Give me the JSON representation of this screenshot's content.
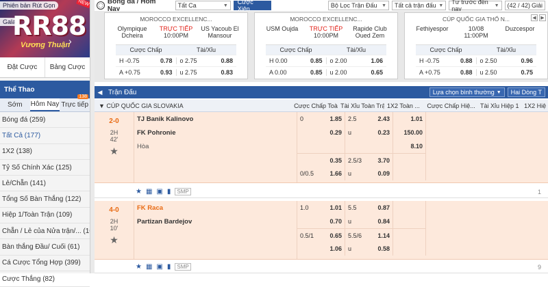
{
  "sidebar": {
    "banner": {
      "pill": "Phiên bản Rút Gọn",
      "pill2": "Gala",
      "logo": "RR88",
      "sub": "Vương Thuận",
      "new": "NEW"
    },
    "links": [
      "Đặt Cược",
      "Bảng Cược"
    ],
    "title": "Thể Thao",
    "tabs": [
      "Sớm",
      "Hôm Nay",
      "Trực tiếp"
    ],
    "live_count": "138",
    "items": [
      {
        "label": "Bóng đá (259)"
      },
      {
        "label": "Tất Cả (177)"
      },
      {
        "label": "1X2 (138)"
      },
      {
        "label": "Tỷ Số Chính Xác (125)"
      },
      {
        "label": "Lẻ/Chẵn (141)"
      },
      {
        "label": "Tổng Số Bàn Thắng (122)"
      },
      {
        "label": "Hiệp 1/Toàn Trận (109)"
      },
      {
        "label": "Chẵn / Lẻ của Nửa trận/... (101)"
      },
      {
        "label": "Bàn thắng Đầu/ Cuối (61)"
      },
      {
        "label": "Cá Cược Tổng Hợp (399)"
      },
      {
        "label": "Cược Thắng (82)"
      }
    ]
  },
  "topbar": {
    "title": "Bóng đá / Hôm Nay",
    "all": "Tất Ca",
    "parlay": "Cược Xiên",
    "filter": "Bộ Lọc Trận Đấu",
    "all_matches": "Tất cả trận đấu",
    "sort": "Tư trước đến nay",
    "count": "(42 / 42)",
    "league_word": "Giải"
  },
  "cards": [
    {
      "league": "MOROCCO EXCELLENC...",
      "home": "Olympique Dcheira",
      "away": "US Yacoub El Mansour",
      "status": "TRỰC TIẾP",
      "time": "10:00PM",
      "h1": "Cược Chấp",
      "h2": "Tài/Xỉu",
      "rows": [
        {
          "a": "H -0.75",
          "b": "0.78",
          "c": "o 2.75",
          "d": "0.88"
        },
        {
          "a": "A +0.75",
          "b": "0.93",
          "c": "u 2.75",
          "d": "0.83"
        }
      ]
    },
    {
      "league": "MOROCCO EXCELLENC...",
      "home": "USM Oujda",
      "away": "Rapide Club Oued Zem",
      "status": "TRỰC TIẾP",
      "time": "10:00PM",
      "h1": "Cược Chấp",
      "h2": "Tài/Xỉu",
      "rows": [
        {
          "a": "H 0.00",
          "b": "0.85",
          "c": "o 2.00",
          "d": "1.06"
        },
        {
          "a": "A 0.00",
          "b": "0.85",
          "c": "u 2.00",
          "d": "0.65"
        }
      ]
    },
    {
      "league": "CÚP QUỐC GIA THỔ N...",
      "home": "Fethiyespor",
      "away": "Duzcespor",
      "status": "10/08",
      "time": "11:00PM",
      "h1": "Cược Chấp",
      "h2": "Tài/Xỉu",
      "rows": [
        {
          "a": "H -0.75",
          "b": "0.88",
          "c": "o 2.50",
          "d": "0.96"
        },
        {
          "a": "A +0.75",
          "b": "0.88",
          "c": "u 2.50",
          "d": "0.75"
        }
      ]
    }
  ],
  "section": {
    "title": "Trận Đấu",
    "view": "Lựa chọn bình thường",
    "lines": "Hai Dòng T"
  },
  "columns": {
    "league": "CÚP QUỐC GIA SLOVAKIA",
    "c1": "Cược Chấp Toà...",
    "c2": "Tài Xỉu Toàn Trận",
    "c3": "1X2 Toàn ...",
    "c4": "Cược Chấp Hiệ...",
    "c5": "Tài Xỉu Hiệp 1",
    "c6": "1X2 Hiệ"
  },
  "matches": [
    {
      "score": "2-0",
      "half": "2H",
      "minute": "42'",
      "home": "TJ Banik Kalinovo",
      "away": "FK Pohronie",
      "draw": "Hòa",
      "rows": [
        {
          "h1": "0",
          "h2": "1.85",
          "t1": "2.5",
          "t2": "2.43",
          "x": "1.01"
        },
        {
          "h1": "",
          "h2": "0.29",
          "t1": "u",
          "t2": "0.23",
          "x": "150.00"
        },
        {
          "h1": "",
          "h2": "",
          "t1": "",
          "t2": "",
          "x": "8.10"
        },
        {
          "h1": "",
          "h2": "0.35",
          "t1": "2.5/3",
          "t2": "3.70",
          "x": ""
        },
        {
          "h1": "0/0.5",
          "h2": "1.66",
          "t1": "u",
          "t2": "0.09",
          "x": ""
        }
      ],
      "smp": "SMP",
      "count": "1"
    },
    {
      "score": "4-0",
      "half": "2H",
      "minute": "10'",
      "home": "FK Raca",
      "away": "Partizan Bardejov",
      "rows": [
        {
          "h1": "1.0",
          "h2": "1.01",
          "t1": "5.5",
          "t2": "0.87",
          "x": ""
        },
        {
          "h1": "",
          "h2": "0.70",
          "t1": "u",
          "t2": "0.84",
          "x": ""
        },
        {
          "h1": "0.5/1",
          "h2": "0.65",
          "t1": "5.5/6",
          "t2": "1.14",
          "x": ""
        },
        {
          "h1": "",
          "h2": "1.06",
          "t1": "u",
          "t2": "0.58",
          "x": ""
        }
      ],
      "smp": "SMP",
      "count": "9"
    }
  ]
}
